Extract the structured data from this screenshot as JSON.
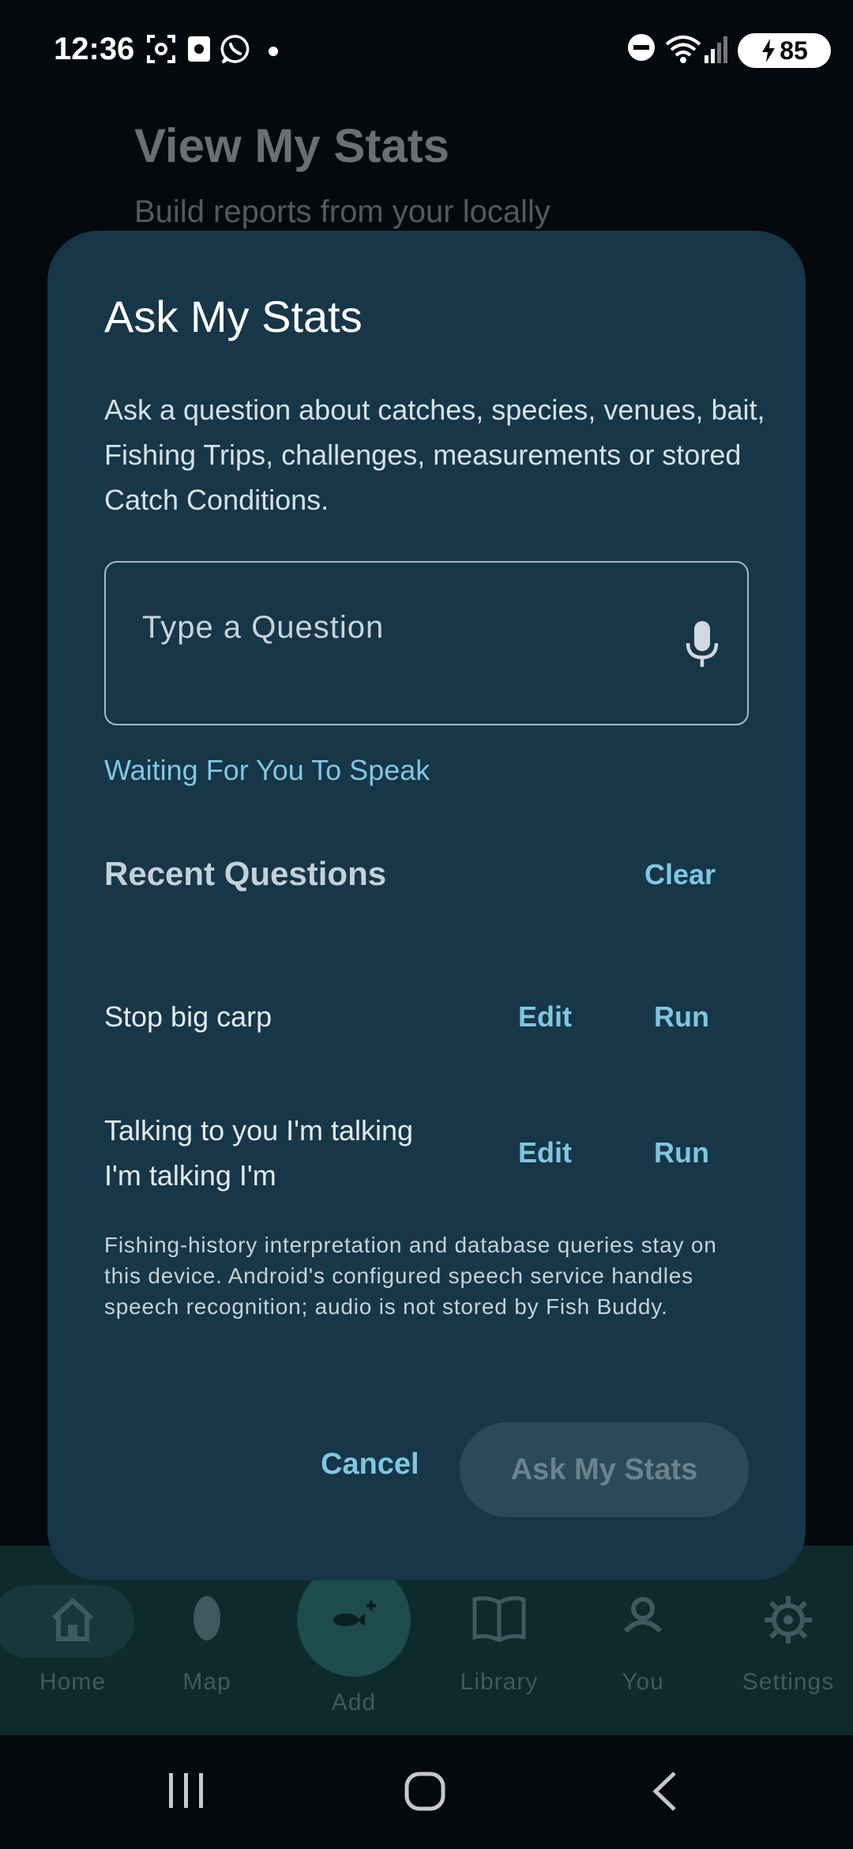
{
  "status_bar": {
    "time": "12:36",
    "battery": "85"
  },
  "background": {
    "title": "View My Stats",
    "subtitle": "Build reports from your locally"
  },
  "dialog": {
    "title": "Ask My Stats",
    "description": "Ask a question about catches, species, venues, bait, Fishing Trips, challenges, measurements or stored Catch Conditions.",
    "question_placeholder": "Type a Question",
    "question_value": "",
    "speech_status": "Waiting For You To Speak",
    "recent_heading": "Recent Questions",
    "clear_label": "Clear",
    "recent_questions": [
      {
        "text": "Stop big carp",
        "edit_label": "Edit",
        "run_label": "Run"
      },
      {
        "text": "Talking to you I'm talking I'm talking I'm",
        "edit_label": "Edit",
        "run_label": "Run"
      }
    ],
    "privacy_note": "Fishing-history interpretation and database queries stay on this device. Android's configured speech service handles speech recognition; audio is not stored by Fish Buddy.",
    "cancel_label": "Cancel",
    "ask_label": "Ask My Stats"
  },
  "bottom_nav": {
    "items": [
      {
        "label": "Home",
        "icon": "home-icon"
      },
      {
        "label": "Map",
        "icon": "map-pin-icon"
      },
      {
        "label": "Add",
        "icon": "fish-add-icon"
      },
      {
        "label": "Library",
        "icon": "book-icon"
      },
      {
        "label": "You",
        "icon": "person-icon"
      },
      {
        "label": "Settings",
        "icon": "gear-icon"
      }
    ]
  },
  "colors": {
    "dialog_bg": "#173648",
    "accent": "#7fc7e1",
    "page_bg": "#05090d",
    "nav_bg": "#0f2a2d"
  }
}
